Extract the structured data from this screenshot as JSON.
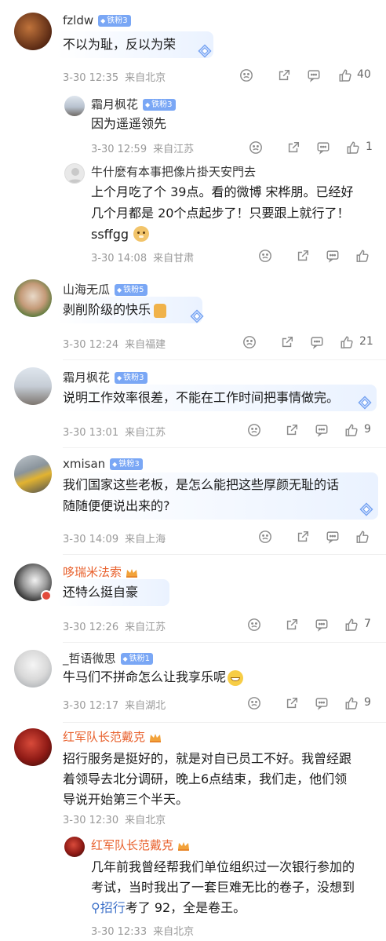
{
  "comments": [
    {
      "name": "fzldw",
      "badge": "铁粉3",
      "text": "不以为耻，反以为荣",
      "time": "3-30 12:35",
      "loc": "来自北京",
      "likes": "40"
    },
    {
      "name": "霜月枫花",
      "badge": "铁粉3",
      "text": "因为遥遥领先",
      "time": "3-30 12:59",
      "loc": "来自江苏",
      "likes": "1"
    },
    {
      "name": "牛什麼有本事把像片掛天安門去",
      "line1": "上个月吃了个 39点。看的微博 宋桦朋。已经好",
      "line2": "几个月都是 20个点起步了！只要跟上就行了！",
      "line3": "ssffgg",
      "time": "3-30 14:08",
      "loc": "来自甘肃",
      "likes": ""
    },
    {
      "name": "山海无瓜",
      "badge": "铁粉5",
      "text": "剥削阶级的快乐",
      "time": "3-30 12:24",
      "loc": "来自福建",
      "likes": "21"
    },
    {
      "name": "霜月枫花",
      "badge": "铁粉3",
      "text": "说明工作效率很差，不能在工作时间把事情做完。",
      "time": "3-30 13:01",
      "loc": "来自江苏",
      "likes": "9"
    },
    {
      "name": "xmisan",
      "badge": "铁粉3",
      "line1": "我们国家这些老板，是怎么能把这些厚颜无耻的话",
      "line2": "随随便便说出来的?",
      "time": "3-30 14:09",
      "loc": "来自上海",
      "likes": ""
    },
    {
      "name": "哆瑞米法索",
      "text": "还特么挺自豪",
      "time": "3-30 12:26",
      "loc": "来自江苏",
      "likes": "7"
    },
    {
      "name": "_哲语微思",
      "badge": "铁粉1",
      "text": "牛马们不拼命怎么让我享乐呢",
      "time": "3-30 12:17",
      "loc": "来自湖北",
      "likes": "9"
    },
    {
      "name": "红军队长范戴克",
      "line1": "招行服务是挺好的，就是对自已员工不好。我曾经跟",
      "line2": "着领导去北分调研，晚上6点结束，我们走，他们领",
      "line3": "导说开始第三个半天。",
      "time": "3-30 12:30",
      "loc": "来自北京",
      "likes": ""
    },
    {
      "name": "红军队长范戴克",
      "line1": "几年前我曾经帮我们单位组织过一次银行参加的",
      "line2": "考试，当时我出了一套巨难无比的卷子，没想到",
      "line3a": "招行",
      "line3b": "考了 92，全是卷王。",
      "time": "3-30 12:33",
      "loc": "来自北京",
      "likes": ""
    }
  ],
  "icons": {
    "emoji": "emoji-icon",
    "share": "share-icon",
    "comment": "comment-icon",
    "like": "like-icon"
  }
}
